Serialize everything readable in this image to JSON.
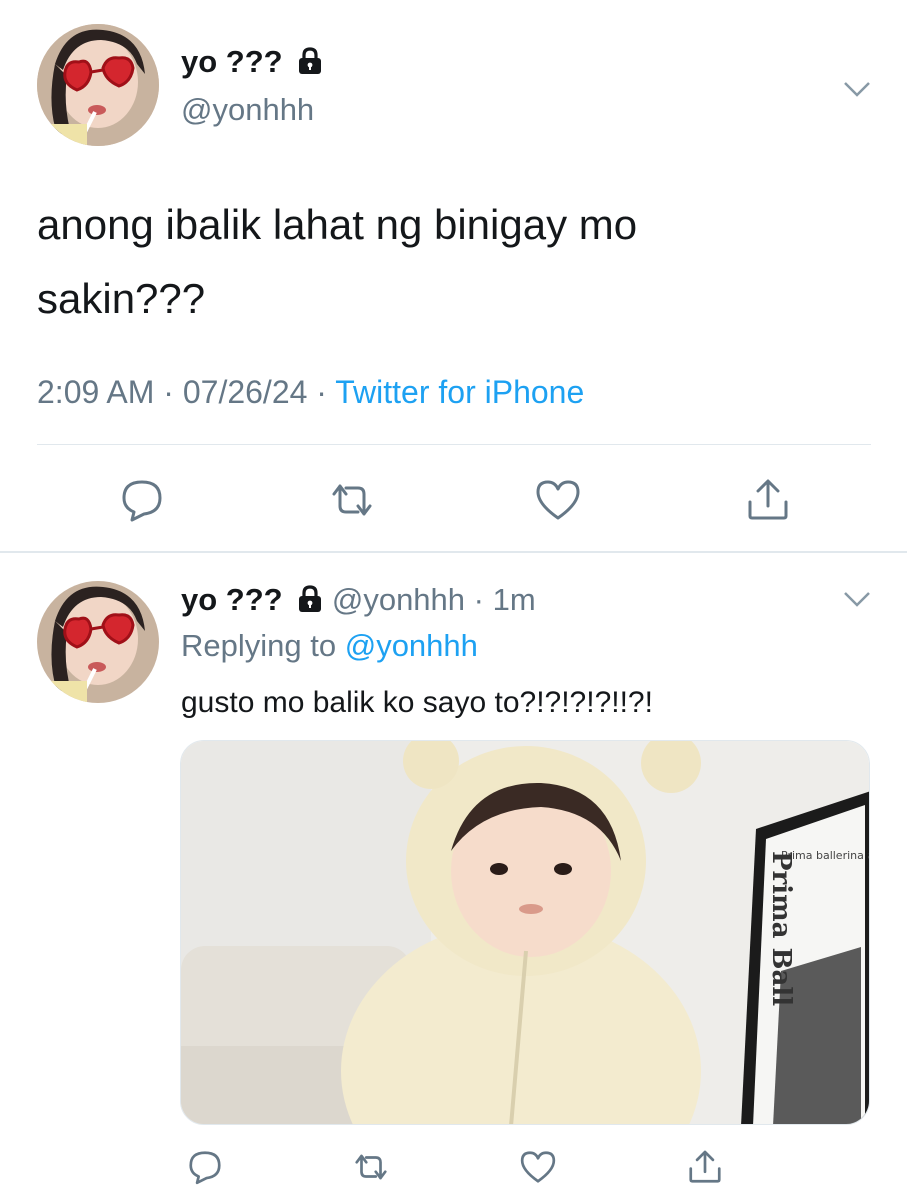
{
  "tweet1": {
    "display_name": "yo ???",
    "handle": "@yonhhh",
    "text_line1": "anong ibalik lahat ng binigay mo",
    "text_line2": "sakin???",
    "time": "2:09 AM",
    "date": "07/26/24",
    "source": "Twitter for iPhone",
    "sep": "·",
    "avatar_icon": "avatar-photo",
    "actions": [
      "reply-icon",
      "retweet-icon",
      "like-icon",
      "share-icon"
    ]
  },
  "tweet2": {
    "display_name": "yo ???",
    "handle": "@yonhhh",
    "time_ago": "· 1m",
    "replying_prefix": "Replying to",
    "replying_to": "@yonhhh",
    "text": "gusto mo balik ko sayo to?!?!?!?!!?!",
    "media_text_title": "Prima Ball",
    "media_text_small": "Prima ballerina assoluta",
    "avatar_icon": "avatar-photo",
    "actions": [
      "reply-icon",
      "retweet-icon",
      "like-icon",
      "share-icon"
    ]
  },
  "colors": {
    "text_primary": "#14171a",
    "text_secondary": "#657786",
    "link_blue": "#1da1f2",
    "divider": "#e1e8ed"
  }
}
